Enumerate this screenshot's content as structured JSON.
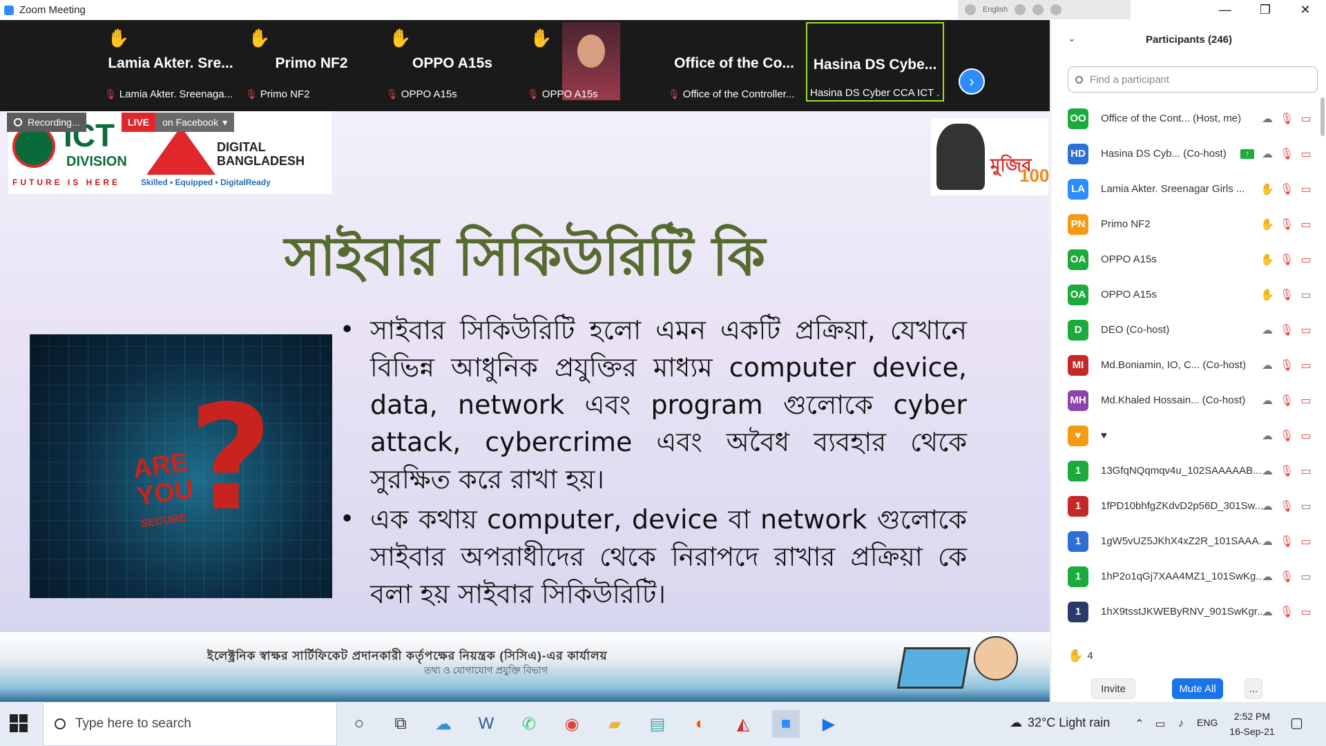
{
  "window": {
    "title": "Zoom Meeting",
    "lang": "English"
  },
  "strip": {
    "tiles": [
      {
        "big": "Lamia Akter. Sre...",
        "small": "Lamia Akter. Sreenaga..."
      },
      {
        "big": "Primo NF2",
        "small": "Primo NF2"
      },
      {
        "big": "OPPO A15s",
        "small": "OPPO A15s"
      },
      {
        "big": "",
        "small": "OPPO A15s"
      },
      {
        "big": "Office of the Co...",
        "small": "Office of the Controller..."
      },
      {
        "big": "Hasina DS Cybe...",
        "small": "Hasina DS Cyber CCA ICT ..."
      }
    ]
  },
  "recording": {
    "label": "Recording...",
    "live": "LIVE",
    "facebook": "on Facebook"
  },
  "slide": {
    "logo_ict": "ICT",
    "logo_division": "DIVISION",
    "logo_future": "FUTURE IS HERE",
    "logo_digital": "DIGITAL",
    "logo_bangladesh": "BANGLADESH",
    "logo_tagline": "Skilled • Equipped • DigitalReady",
    "mujib_text": "মুজিব",
    "mujib_100": "100",
    "title": "সাইবার সিকিউরিটি কি",
    "image_are": "ARE",
    "image_you": "YOU",
    "image_secure": "SECURE",
    "bullets": [
      "সাইবার সিকিউরিটি হলো এমন একটি প্রক্রিয়া, যেখানে বিভিন্ন আধুনিক প্রযুক্তির মাধ্যম computer device, data, network এবং program গুলোকে cyber attack, cybercrime এবং অবৈধ ব্যবহার থেকে সুরক্ষিত করে রাখা হয়।",
      "এক কথায় computer, device বা network গুলোকে সাইবার অপরাধীদের থেকে নিরাপদে রাখার প্রক্রিয়া কে বলা হয় সাইবার সিকিউরিটি।"
    ],
    "footer_line1": "ইলেক্ট্রনিক স্বাক্ষর সার্টিফিকেট প্রদানকারী কর্তৃপক্ষের নিয়ন্ত্রক (সিসিএ)-এর কার্যালয়",
    "footer_line2": "তথ্য ও যোগাযোগ প্রযুক্তি বিভাগ"
  },
  "panel": {
    "title": "Participants (246)",
    "search_placeholder": "Find a participant",
    "raised_count": "4",
    "invite": "Invite",
    "mute_all": "Mute All",
    "more": "...",
    "participants": [
      {
        "initials": "OO",
        "color": "#1aab3c",
        "name": "Office of the Cont...  (Host, me)",
        "hand": false,
        "video": false
      },
      {
        "initials": "HD",
        "color": "#2d6fd6",
        "name": "Hasina DS Cyb...  (Co-host)",
        "hand": false,
        "video": false,
        "share": true
      },
      {
        "initials": "LA",
        "color": "#2d8cff",
        "name": "Lamia Akter. Sreenagar Girls ...",
        "hand": true,
        "video": false
      },
      {
        "initials": "PN",
        "color": "#f59a12",
        "name": "Primo NF2",
        "hand": true,
        "video": false
      },
      {
        "initials": "OA",
        "color": "#1aab3c",
        "name": "OPPO A15s",
        "hand": true,
        "video": false
      },
      {
        "initials": "OA",
        "color": "#1aab3c",
        "name": "OPPO A15s",
        "hand": true,
        "video": true
      },
      {
        "initials": "D",
        "color": "#1aab3c",
        "name": "DEO (Co-host)",
        "hand": false,
        "video": false
      },
      {
        "initials": "MI",
        "color": "#c62828",
        "name": "Md.Boniamin, IO, C...  (Co-host)",
        "hand": false,
        "video": false
      },
      {
        "initials": "MH",
        "color": "#8e44ad",
        "name": "Md.Khaled Hossain...  (Co-host)",
        "hand": false,
        "video": false
      },
      {
        "initials": "♥",
        "color": "#f59a12",
        "name": "♥",
        "hand": false,
        "video": false
      },
      {
        "initials": "1",
        "color": "#1aab3c",
        "name": "13GfqNQqmqv4u_102SAAAAAB...",
        "hand": false,
        "video": false
      },
      {
        "initials": "1",
        "color": "#c62828",
        "name": "1fPD10bhfgZKdvD2p56D_301Sw...",
        "hand": false,
        "video": true
      },
      {
        "initials": "1",
        "color": "#2d6fd6",
        "name": "1gW5vUZ5JKhX4xZ2R_101SAAA...",
        "hand": false,
        "video": false
      },
      {
        "initials": "1",
        "color": "#1aab3c",
        "name": "1hP2o1qGj7XAA4MZ1_101SwKg...",
        "hand": false,
        "video": true
      },
      {
        "initials": "1",
        "color": "#2b3a6b",
        "name": "1hX9tsstJKWEByRNV_901SwKgr...",
        "hand": false,
        "video": false
      }
    ]
  },
  "taskbar": {
    "search_placeholder": "Type here to search",
    "weather": "32°C  Light rain",
    "lang": "ENG",
    "time": "2:52 PM",
    "date": "16-Sep-21"
  }
}
